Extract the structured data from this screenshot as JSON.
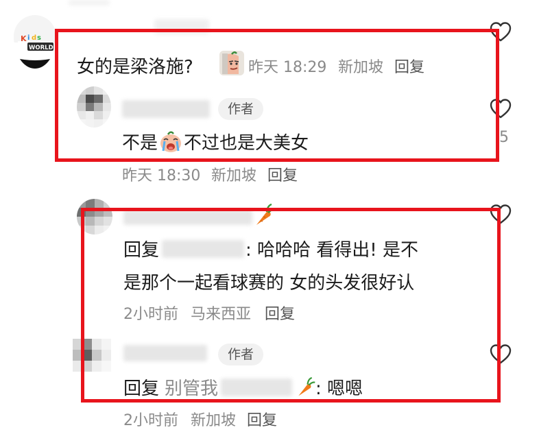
{
  "comment1": {
    "text": "女的是梁洛施?",
    "time": "昨天 18:29",
    "location": "新加坡",
    "reply_label": "回复",
    "avatar_logo_text": "WORLD"
  },
  "reply1": {
    "badge": "作者",
    "text_a": "不是",
    "text_b": "不过也是大美女",
    "time": "昨天 18:30",
    "location": "新加坡",
    "reply_label": "回复"
  },
  "comment2": {
    "reply_prefix": "回复",
    "line1": ": 哈哈哈 看得出! 是不",
    "line2": "是那个一起看球赛的 女的头发很好认",
    "time": "2小时前",
    "location": "马来西亚",
    "reply_label": "回复"
  },
  "reply2": {
    "badge": "作者",
    "reply_prefix": "回复",
    "reply_to": "别管我",
    "text": ": 嗯嗯",
    "time": "2小时前",
    "location": "新加坡",
    "reply_label": "回复"
  },
  "side_count": "5",
  "colors": {
    "highlight": "#e8141c",
    "meta": "#8a8a8a",
    "text": "#1b1b1b"
  },
  "icons": [
    "heart-outline-icon",
    "carrot-icon",
    "smirk-face-icon",
    "crying-face-icon"
  ]
}
